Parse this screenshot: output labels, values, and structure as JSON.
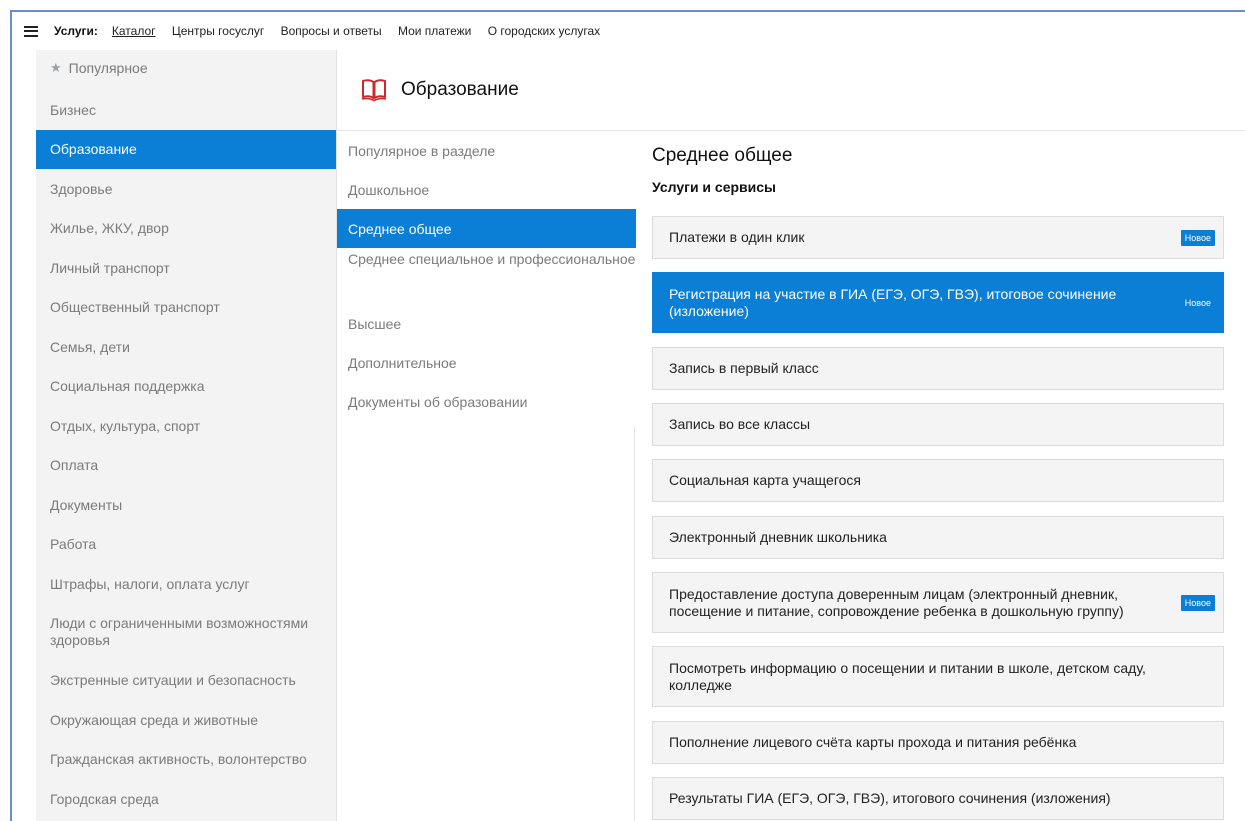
{
  "topbar": {
    "services_label": "Услуги:",
    "nav": [
      "Каталог",
      "Центры госуслуг",
      "Вопросы и ответы",
      "Мои платежи",
      "О городских услугах"
    ]
  },
  "sidebar": {
    "items": [
      "Популярное",
      "Бизнес",
      "Образование",
      "Здоровье",
      "Жилье, ЖКУ, двор",
      "Личный транспорт",
      "Общественный транспорт",
      "Семья, дети",
      "Социальная поддержка",
      "Отдых, культура, спорт",
      "Оплата",
      "Документы",
      "Работа",
      "Штрафы, налоги, оплата услуг",
      "Люди с ограниченными возможностями здоровья",
      "Экстренные ситуации и безопасность",
      "Окружающая среда и животные",
      "Гражданская активность, волонтерство",
      "Городская среда"
    ],
    "active_index": 2
  },
  "section": {
    "title": "Образование"
  },
  "subnav": {
    "items": [
      "Популярное в разделе",
      "Дошкольное",
      "Среднее общее",
      "Среднее специальное и профессиональное",
      "Высшее",
      "Дополнительное",
      "Документы об образовании"
    ],
    "active_index": 2
  },
  "content": {
    "title": "Среднее общее",
    "subtitle": "Услуги и сервисы",
    "badge_label": "Новое",
    "cards": [
      {
        "text": "Платежи в один клик",
        "is_new": true
      },
      {
        "text": "Регистрация на участие в ГИА (ЕГЭ, ОГЭ, ГВЭ), итоговое сочинение (изложение)",
        "is_new": true
      },
      {
        "text": "Запись в первый класс",
        "is_new": false
      },
      {
        "text": "Запись во все классы",
        "is_new": false
      },
      {
        "text": "Социальная карта учащегося",
        "is_new": false
      },
      {
        "text": "Электронный дневник школьника",
        "is_new": false
      },
      {
        "text": "Предоставление доступа доверенным лицам (электронный дневник, посещение и питание, сопровождение ребенка в дошкольную группу)",
        "is_new": true
      },
      {
        "text": "Посмотреть информацию о посещении и питании в школе, детском саду, колледже",
        "is_new": false
      },
      {
        "text": "Пополнение лицевого счёта карты прохода и питания ребёнка",
        "is_new": false
      },
      {
        "text": "Результаты ГИА (ЕГЭ, ОГЭ, ГВЭ), итогового сочинения (изложения)",
        "is_new": false
      }
    ]
  },
  "colors": {
    "accent": "#0b7fd6",
    "icon_red": "#d0262c",
    "sidebar_bg": "#f3f3f3"
  }
}
